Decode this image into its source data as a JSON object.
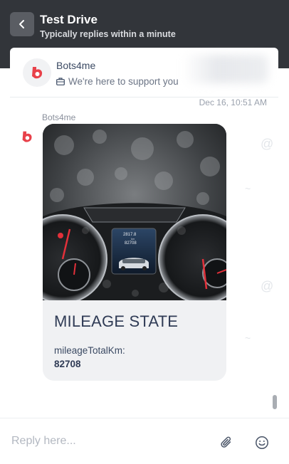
{
  "header": {
    "title": "Test Drive",
    "subtitle": "Typically replies within a minute",
    "back_icon": "chevron-left-icon"
  },
  "bot": {
    "name": "Bots4me",
    "status": "We're here to support you",
    "status_icon": "briefcase-icon",
    "brand_color": "#e8414a"
  },
  "chat": {
    "timestamp": "Dec 16, 10:51 AM",
    "sender": "Bots4me",
    "card": {
      "title": "MILEAGE STATE",
      "field_label": "mileageTotalKm:",
      "field_value": "82708",
      "image_subject": "car-dashboard-photo",
      "dashboard_readout_top": "2817.8",
      "dashboard_readout_unit": "km",
      "dashboard_readout_total": "82708"
    }
  },
  "composer": {
    "placeholder": "Reply here...",
    "attach_icon": "paperclip-icon",
    "emoji_icon": "smiley-icon"
  }
}
